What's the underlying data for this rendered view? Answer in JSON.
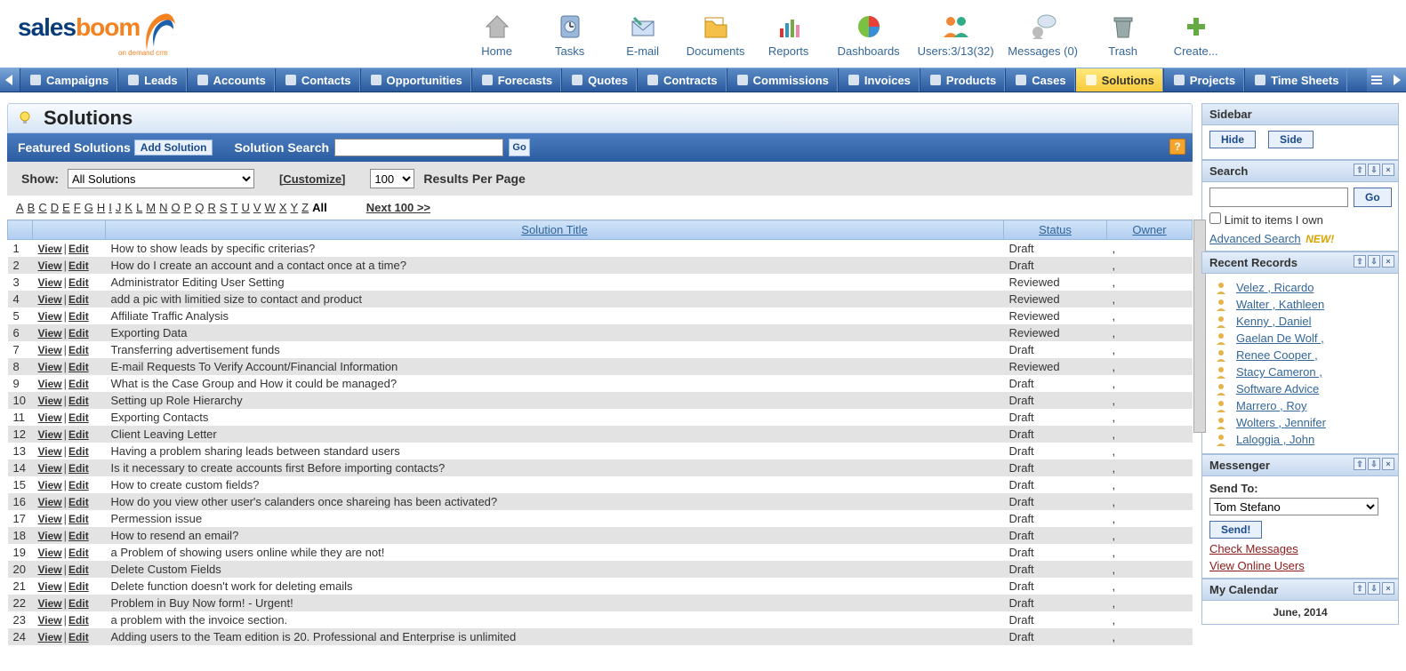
{
  "topIcons": [
    {
      "id": "home",
      "label": "Home"
    },
    {
      "id": "tasks",
      "label": "Tasks"
    },
    {
      "id": "email",
      "label": "E-mail"
    },
    {
      "id": "documents",
      "label": "Documents"
    },
    {
      "id": "reports",
      "label": "Reports"
    },
    {
      "id": "dashboards",
      "label": "Dashboards"
    },
    {
      "id": "users",
      "label": "Users:3/13(32)"
    },
    {
      "id": "messages",
      "label": "Messages (0)"
    },
    {
      "id": "trash",
      "label": "Trash"
    },
    {
      "id": "create",
      "label": "Create..."
    }
  ],
  "tabs": [
    "Campaigns",
    "Leads",
    "Accounts",
    "Contacts",
    "Opportunities",
    "Forecasts",
    "Quotes",
    "Contracts",
    "Commissions",
    "Invoices",
    "Products",
    "Cases",
    "Solutions",
    "Projects",
    "Time Sheets"
  ],
  "activeTab": "Solutions",
  "page": {
    "title": "Solutions",
    "featured": "Featured Solutions",
    "addSolution": "Add Solution",
    "searchLabel": "Solution Search",
    "go": "Go",
    "show": "Show:",
    "showOptions": [
      "All Solutions"
    ],
    "customize": "[Customize]",
    "perPage": "100",
    "resultsPerPage": "Results Per Page",
    "alphabet": [
      "A",
      "B",
      "C",
      "D",
      "E",
      "F",
      "G",
      "H",
      "I",
      "J",
      "K",
      "L",
      "M",
      "N",
      "O",
      "P",
      "Q",
      "R",
      "S",
      "T",
      "U",
      "V",
      "W",
      "X",
      "Y",
      "Z"
    ],
    "all": "All",
    "next": "Next 100 >>",
    "cols": {
      "title": "Solution Title",
      "status": "Status",
      "owner": "Owner"
    },
    "view": "View",
    "edit": "Edit",
    "rows": [
      {
        "n": 1,
        "title": "How to show leads by specific criterias?",
        "status": "Draft",
        "owner": ","
      },
      {
        "n": 2,
        "title": "How do I create an account and a contact once at a time?",
        "status": "Draft",
        "owner": ","
      },
      {
        "n": 3,
        "title": "Administrator Editing User Setting",
        "status": "Reviewed",
        "owner": ","
      },
      {
        "n": 4,
        "title": "add a pic with limitied size to contact and product",
        "status": "Reviewed",
        "owner": ","
      },
      {
        "n": 5,
        "title": "Affiliate Traffic Analysis",
        "status": "Reviewed",
        "owner": ","
      },
      {
        "n": 6,
        "title": "Exporting Data",
        "status": "Reviewed",
        "owner": ","
      },
      {
        "n": 7,
        "title": "Transferring advertisement funds",
        "status": "Draft",
        "owner": ","
      },
      {
        "n": 8,
        "title": "E-mail Requests To Verify Account/Financial Information",
        "status": "Reviewed",
        "owner": ","
      },
      {
        "n": 9,
        "title": "What is the Case Group and How it could be managed?",
        "status": "Draft",
        "owner": ","
      },
      {
        "n": 10,
        "title": "Setting up Role Hierarchy",
        "status": "Draft",
        "owner": ","
      },
      {
        "n": 11,
        "title": "Exporting Contacts",
        "status": "Draft",
        "owner": ","
      },
      {
        "n": 12,
        "title": "Client Leaving Letter",
        "status": "Draft",
        "owner": ","
      },
      {
        "n": 13,
        "title": "Having a problem sharing leads between standard users",
        "status": "Draft",
        "owner": ","
      },
      {
        "n": 14,
        "title": "Is it necessary to create accounts first Before importing contacts?",
        "status": "Draft",
        "owner": ","
      },
      {
        "n": 15,
        "title": "How to create custom fields?",
        "status": "Draft",
        "owner": ","
      },
      {
        "n": 16,
        "title": "How do you view other user's calanders once shareing has been activated?",
        "status": "Draft",
        "owner": ","
      },
      {
        "n": 17,
        "title": "Permession issue",
        "status": "Draft",
        "owner": ","
      },
      {
        "n": 18,
        "title": "How to resend an email?",
        "status": "Draft",
        "owner": ","
      },
      {
        "n": 19,
        "title": "a Problem of showing users online while they are not!",
        "status": "Draft",
        "owner": ","
      },
      {
        "n": 20,
        "title": "Delete Custom Fields",
        "status": "Draft",
        "owner": ","
      },
      {
        "n": 21,
        "title": "Delete function doesn't work for deleting emails",
        "status": "Draft",
        "owner": ","
      },
      {
        "n": 22,
        "title": "Problem in Buy Now form! - Urgent!",
        "status": "Draft",
        "owner": ","
      },
      {
        "n": 23,
        "title": "a problem with the invoice section.",
        "status": "Draft",
        "owner": ","
      },
      {
        "n": 24,
        "title": "Adding users to the Team edition is 20. Professional and Enterprise is unlimited",
        "status": "Draft",
        "owner": ","
      }
    ]
  },
  "sidebar": {
    "title": "Sidebar",
    "hide": "Hide",
    "sideBtn": "Side",
    "search": {
      "title": "Search",
      "go": "Go",
      "limit": "Limit to items I own",
      "advanced": "Advanced Search",
      "new": "NEW!"
    },
    "recent": {
      "title": "Recent Records",
      "items": [
        "Velez , Ricardo",
        "Walter , Kathleen",
        "Kenny , Daniel",
        "Gaelan De Wolf ,",
        "Renee Cooper ,",
        "Stacy Cameron ,",
        "Software Advice",
        "Marrero , Roy",
        "Wolters , Jennifer",
        "Laloggia , John"
      ]
    },
    "messenger": {
      "title": "Messenger",
      "sendTo": "Send To:",
      "selected": "Tom Stefano",
      "send": "Send!",
      "check": "Check Messages",
      "online": "View Online Users"
    },
    "calendar": {
      "title": "My Calendar",
      "month": "June, 2014"
    }
  }
}
